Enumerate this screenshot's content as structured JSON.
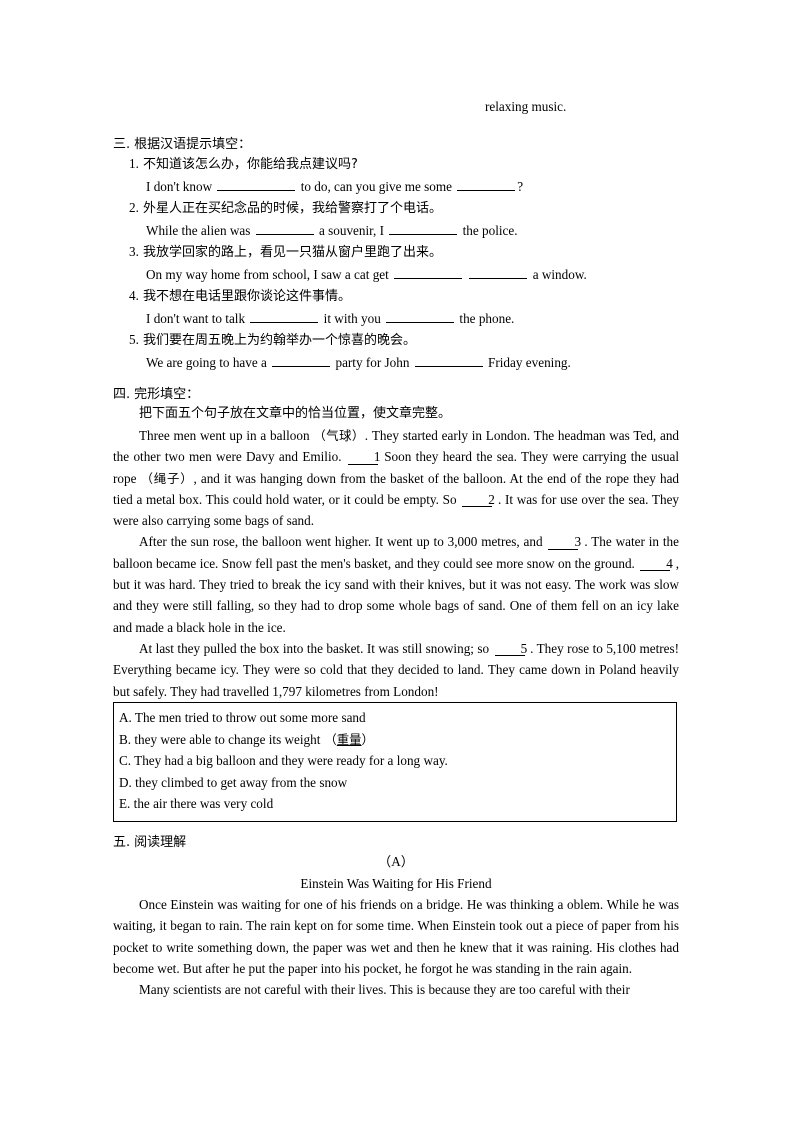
{
  "page": {
    "stray_line": "relaxing music."
  },
  "section_three": {
    "number": "三.",
    "title": "根据汉语提示填空：",
    "items": [
      {
        "index": "1.",
        "chinese": "不知道该怎么办，你能给我点建议吗?",
        "english_parts": [
          "I don't know ",
          " to do, can you give me some ",
          "?"
        ],
        "blanks": [
          "b-xl",
          "b-md"
        ]
      },
      {
        "index": "2.",
        "chinese": "外星人正在买纪念品的时候，我给警察打了个电话。",
        "english_parts": [
          "While the alien was ",
          " a souvenir, I ",
          " the police."
        ],
        "blanks": [
          "b-md",
          "b-lg"
        ]
      },
      {
        "index": "3.",
        "chinese": "我放学回家的路上，看见一只猫从窗户里跑了出来。",
        "english_parts": [
          "On my way home from school, I saw a cat get ",
          " ",
          " a window."
        ],
        "blanks": [
          "b-lg",
          "b-md"
        ]
      },
      {
        "index": "4.",
        "chinese": "我不想在电话里跟你谈论这件事情。",
        "english_parts": [
          "I don't want to talk ",
          " it with you ",
          " the phone."
        ],
        "blanks": [
          "b-lg",
          "b-lg"
        ]
      },
      {
        "index": "5.",
        "chinese": "我们要在周五晚上为约翰举办一个惊喜的晚会。",
        "english_parts": [
          "We are going to have a ",
          " party for John ",
          " Friday evening."
        ],
        "blanks": [
          "b-md",
          "b-lg"
        ]
      }
    ]
  },
  "section_four": {
    "number": "四.",
    "title": "完形填空：",
    "instruction": "把下面五个句子放在文章中的恰当位置，使文章完整。",
    "paragraphs": [
      {
        "id": "p1",
        "segments": [
          {
            "t": "text",
            "v": "Three men went up in a balloon"
          },
          {
            "t": "cn",
            "v": "（气球）"
          },
          {
            "t": "text",
            "v": ". They started early in London. The headman was Ted, and the other two men were Davy and Emilio."
          },
          {
            "t": "blank",
            "v": "1"
          },
          {
            "t": "text",
            "v": "Soon they heard the sea. They were carrying the usual rope"
          },
          {
            "t": "cn",
            "v": "（绳子）"
          },
          {
            "t": "text",
            "v": ", and it was hanging down from the basket of the balloon. At the end of the rope they had tied a metal box. This could hold water, or it could be empty. So"
          },
          {
            "t": "blank",
            "v": "2"
          },
          {
            "t": "text",
            "v": ". It was for use over the sea. They were also carrying some bags of sand."
          }
        ]
      },
      {
        "id": "p2",
        "segments": [
          {
            "t": "text",
            "v": "After the sun rose, the balloon went higher. It went up to 3,000 metres, and"
          },
          {
            "t": "blank",
            "v": "3"
          },
          {
            "t": "text",
            "v": ". The water in the balloon became ice. Snow fell past the men's basket, and they could see more snow on the ground."
          },
          {
            "t": "blank",
            "v": "4"
          },
          {
            "t": "text",
            "v": ", but it was hard. They tried to break the icy sand with their knives, but it was not easy. The work was slow and they were still falling, so they had to drop some whole bags of sand. One of them fell on an icy lake and made a black hole in the ice."
          }
        ]
      },
      {
        "id": "p3",
        "segments": [
          {
            "t": "text",
            "v": "At last they pulled the box into the basket. It was still snowing; so"
          },
          {
            "t": "blank",
            "v": "5"
          },
          {
            "t": "text",
            "v": ". They rose to 5,100 metres! Everything became icy. They were so cold that they decided to land. They came down in Poland heavily but safely. They had travelled 1,797 kilometres from London!"
          }
        ]
      }
    ],
    "options": [
      {
        "letter": "A.",
        "text": "The men tried to throw out some more sand",
        "cn_note": "",
        "cn_underline": ""
      },
      {
        "letter": "B.",
        "text": "they were able to change its weight",
        "cn_note": "（",
        "cn_underline": "重量",
        "cn_close": "）"
      },
      {
        "letter": "C.",
        "text": "They had a big balloon and they were ready for a long way.",
        "cn_note": "",
        "cn_underline": ""
      },
      {
        "letter": "D.",
        "text": "they climbed to get away from the snow",
        "cn_note": "",
        "cn_underline": ""
      },
      {
        "letter": "E.",
        "text": "the air there was very cold",
        "cn_note": "",
        "cn_underline": ""
      }
    ]
  },
  "section_five": {
    "number": "五.",
    "title": "阅读理解",
    "article_label": "（A）",
    "article_title": "Einstein Was Waiting for His Friend",
    "paragraphs": [
      "Once Einstein was waiting for one of his friends on a bridge. He was thinking a oblem. While he was waiting, it began to rain. The rain kept on for some time. When Einstein took out a piece of paper from his pocket to write something down, the paper was wet and then he knew that it was raining. His clothes had become wet. But after he put the paper into his pocket, he forgot he was standing in the rain again.",
      "Many scientists are not careful with their lives. This is because they are too careful with their"
    ]
  }
}
